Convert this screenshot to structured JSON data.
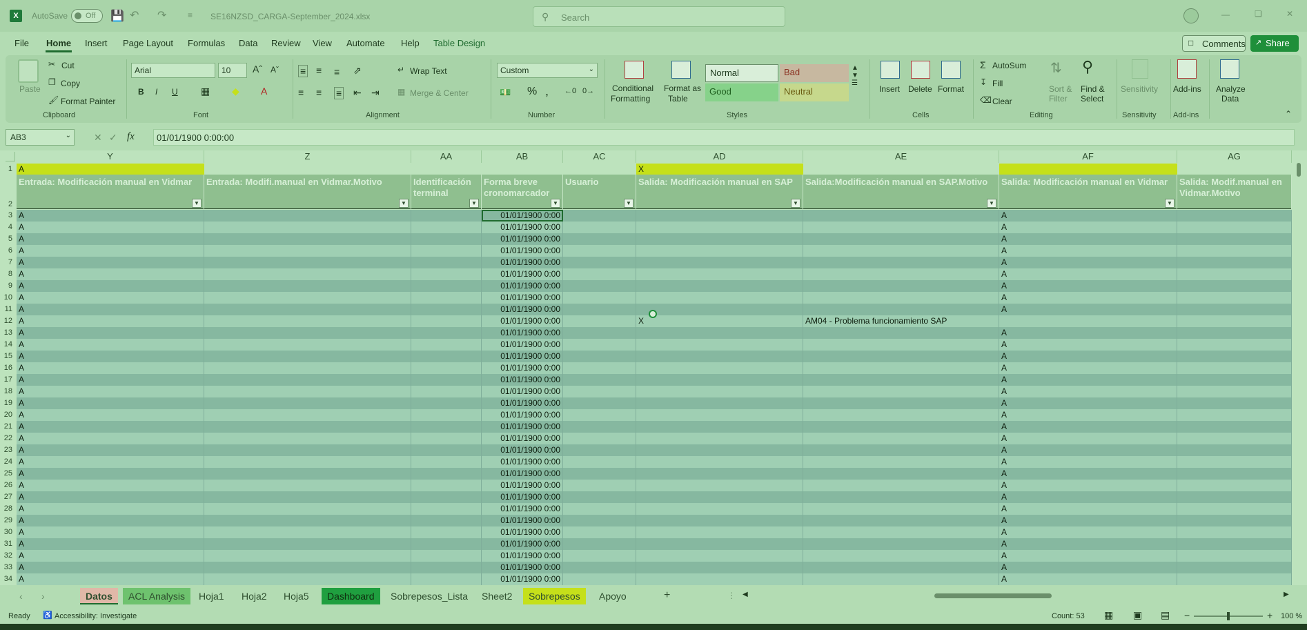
{
  "titlebar": {
    "app_icon": "excel-icon",
    "autosave_label": "AutoSave",
    "autosave_state": "Off",
    "filename": "SE16NZSD_CARGA-September_2024.xlsx",
    "search_placeholder": "Search"
  },
  "menu": [
    "File",
    "Home",
    "Insert",
    "Page Layout",
    "Formulas",
    "Data",
    "Review",
    "View",
    "Automate",
    "Help",
    "Table Design"
  ],
  "menu_active": "Home",
  "comments_label": "Comments",
  "share_label": "Share",
  "ribbon": {
    "clipboard": {
      "paste": "Paste",
      "cut": "Cut",
      "copy": "Copy",
      "format_painter": "Format Painter",
      "label": "Clipboard"
    },
    "font": {
      "name": "Arial",
      "size": "10",
      "label": "Font"
    },
    "alignment": {
      "wrap": "Wrap Text",
      "merge": "Merge & Center",
      "label": "Alignment"
    },
    "number": {
      "format": "Custom",
      "label": "Number"
    },
    "styles": {
      "conditional": "Conditional",
      "formatting": "Formatting",
      "format_as": "Format as",
      "table": "Table",
      "normal": "Normal",
      "bad": "Bad",
      "good": "Good",
      "neutral": "Neutral",
      "label": "Styles"
    },
    "cells": {
      "insert": "Insert",
      "delete": "Delete",
      "format": "Format",
      "label": "Cells"
    },
    "editing": {
      "autosum": "AutoSum",
      "fill": "Fill",
      "clear": "Clear",
      "sort1": "Sort &",
      "sort2": "Filter",
      "find1": "Find &",
      "find2": "Select",
      "label": "Editing"
    },
    "sensitivity": {
      "btn": "Sensitivity",
      "label": "Sensitivity"
    },
    "addins": {
      "btn": "Add-ins",
      "label": "Add-ins"
    },
    "analyze": {
      "l1": "Analyze",
      "l2": "Data"
    }
  },
  "formula_bar": {
    "name_box": "AB3",
    "fx": "fx",
    "value": "01/01/1900  0:00:00"
  },
  "columns": [
    {
      "letter": "Y",
      "header": "Entrada: Modificación manual en Vidmar",
      "row1": "A"
    },
    {
      "letter": "Z",
      "header": "Entrada: Modifi.manual en Vidmar.Motivo",
      "row1": ""
    },
    {
      "letter": "AA",
      "header": "Identificación terminal",
      "row1": ""
    },
    {
      "letter": "AB",
      "header": "Forma breve cronomarcador",
      "row1": ""
    },
    {
      "letter": "AC",
      "header": "Usuario",
      "row1": ""
    },
    {
      "letter": "AD",
      "header": "Salida: Modificación manual en SAP",
      "row1": "X"
    },
    {
      "letter": "AE",
      "header": "Salida:Modificación manual en SAP.Motivo",
      "row1": ""
    },
    {
      "letter": "AF",
      "header": "Salida: Modificación manual en Vidmar",
      "row1": ""
    },
    {
      "letter": "AG",
      "header": "Salida: Modif.manual en Vidmar.Motivo",
      "row1": ""
    }
  ],
  "rows": [
    {
      "n": "3",
      "Y": "A",
      "AB": "01/01/1900 0:00",
      "AD": "",
      "AE": "",
      "AF": "A"
    },
    {
      "n": "4",
      "Y": "A",
      "AB": "01/01/1900 0:00",
      "AD": "",
      "AE": "",
      "AF": "A"
    },
    {
      "n": "5",
      "Y": "A",
      "AB": "01/01/1900 0:00",
      "AD": "",
      "AE": "",
      "AF": "A"
    },
    {
      "n": "6",
      "Y": "A",
      "AB": "01/01/1900 0:00",
      "AD": "",
      "AE": "",
      "AF": "A"
    },
    {
      "n": "7",
      "Y": "A",
      "AB": "01/01/1900 0:00",
      "AD": "",
      "AE": "",
      "AF": "A"
    },
    {
      "n": "8",
      "Y": "A",
      "AB": "01/01/1900 0:00",
      "AD": "",
      "AE": "",
      "AF": "A"
    },
    {
      "n": "9",
      "Y": "A",
      "AB": "01/01/1900 0:00",
      "AD": "",
      "AE": "",
      "AF": "A"
    },
    {
      "n": "10",
      "Y": "A",
      "AB": "01/01/1900 0:00",
      "AD": "",
      "AE": "",
      "AF": "A"
    },
    {
      "n": "11",
      "Y": "A",
      "AB": "01/01/1900 0:00",
      "AD": "",
      "AE": "",
      "AF": "A"
    },
    {
      "n": "12",
      "Y": "A",
      "AB": "01/01/1900 0:00",
      "AD": "X",
      "AE": "AM04 - Problema funcionamiento SAP",
      "AF": ""
    },
    {
      "n": "13",
      "Y": "A",
      "AB": "01/01/1900 0:00",
      "AD": "",
      "AE": "",
      "AF": "A"
    },
    {
      "n": "14",
      "Y": "A",
      "AB": "01/01/1900 0:00",
      "AD": "",
      "AE": "",
      "AF": "A"
    },
    {
      "n": "15",
      "Y": "A",
      "AB": "01/01/1900 0:00",
      "AD": "",
      "AE": "",
      "AF": "A"
    },
    {
      "n": "16",
      "Y": "A",
      "AB": "01/01/1900 0:00",
      "AD": "",
      "AE": "",
      "AF": "A"
    },
    {
      "n": "17",
      "Y": "A",
      "AB": "01/01/1900 0:00",
      "AD": "",
      "AE": "",
      "AF": "A"
    },
    {
      "n": "18",
      "Y": "A",
      "AB": "01/01/1900 0:00",
      "AD": "",
      "AE": "",
      "AF": "A"
    },
    {
      "n": "19",
      "Y": "A",
      "AB": "01/01/1900 0:00",
      "AD": "",
      "AE": "",
      "AF": "A"
    },
    {
      "n": "20",
      "Y": "A",
      "AB": "01/01/1900 0:00",
      "AD": "",
      "AE": "",
      "AF": "A"
    },
    {
      "n": "21",
      "Y": "A",
      "AB": "01/01/1900 0:00",
      "AD": "",
      "AE": "",
      "AF": "A"
    },
    {
      "n": "22",
      "Y": "A",
      "AB": "01/01/1900 0:00",
      "AD": "",
      "AE": "",
      "AF": "A"
    },
    {
      "n": "23",
      "Y": "A",
      "AB": "01/01/1900 0:00",
      "AD": "",
      "AE": "",
      "AF": "A"
    },
    {
      "n": "24",
      "Y": "A",
      "AB": "01/01/1900 0:00",
      "AD": "",
      "AE": "",
      "AF": "A"
    },
    {
      "n": "25",
      "Y": "A",
      "AB": "01/01/1900 0:00",
      "AD": "",
      "AE": "",
      "AF": "A"
    },
    {
      "n": "26",
      "Y": "A",
      "AB": "01/01/1900 0:00",
      "AD": "",
      "AE": "",
      "AF": "A"
    },
    {
      "n": "27",
      "Y": "A",
      "AB": "01/01/1900 0:00",
      "AD": "",
      "AE": "",
      "AF": "A"
    },
    {
      "n": "28",
      "Y": "A",
      "AB": "01/01/1900 0:00",
      "AD": "",
      "AE": "",
      "AF": "A"
    },
    {
      "n": "29",
      "Y": "A",
      "AB": "01/01/1900 0:00",
      "AD": "",
      "AE": "",
      "AF": "A"
    },
    {
      "n": "30",
      "Y": "A",
      "AB": "01/01/1900 0:00",
      "AD": "",
      "AE": "",
      "AF": "A"
    },
    {
      "n": "31",
      "Y": "A",
      "AB": "01/01/1900 0:00",
      "AD": "",
      "AE": "",
      "AF": "A"
    },
    {
      "n": "32",
      "Y": "A",
      "AB": "01/01/1900 0:00",
      "AD": "",
      "AE": "",
      "AF": "A"
    },
    {
      "n": "33",
      "Y": "A",
      "AB": "01/01/1900 0:00",
      "AD": "",
      "AE": "",
      "AF": "A"
    },
    {
      "n": "34",
      "Y": "A",
      "AB": "01/01/1900 0:00",
      "AD": "",
      "AE": "",
      "AF": "A"
    }
  ],
  "sheets": [
    "Datos",
    "ACL Analysis",
    "Hoja1",
    "Hoja2",
    "Hoja5",
    "Dashboard",
    "Sobrepesos_Lista",
    "Sheet2",
    "Sobrepesos",
    "Apoyo"
  ],
  "active_sheet": "Datos",
  "status": {
    "ready": "Ready",
    "accessibility": "Accessibility: Investigate",
    "count": "Count: 53",
    "zoom": "100 %"
  },
  "colors": {
    "accent_green": "#1f8f3a",
    "yellow_highlight": "#c5e01a",
    "header_fill": "#8fbf8f",
    "band_fill": "#86b8a0"
  }
}
